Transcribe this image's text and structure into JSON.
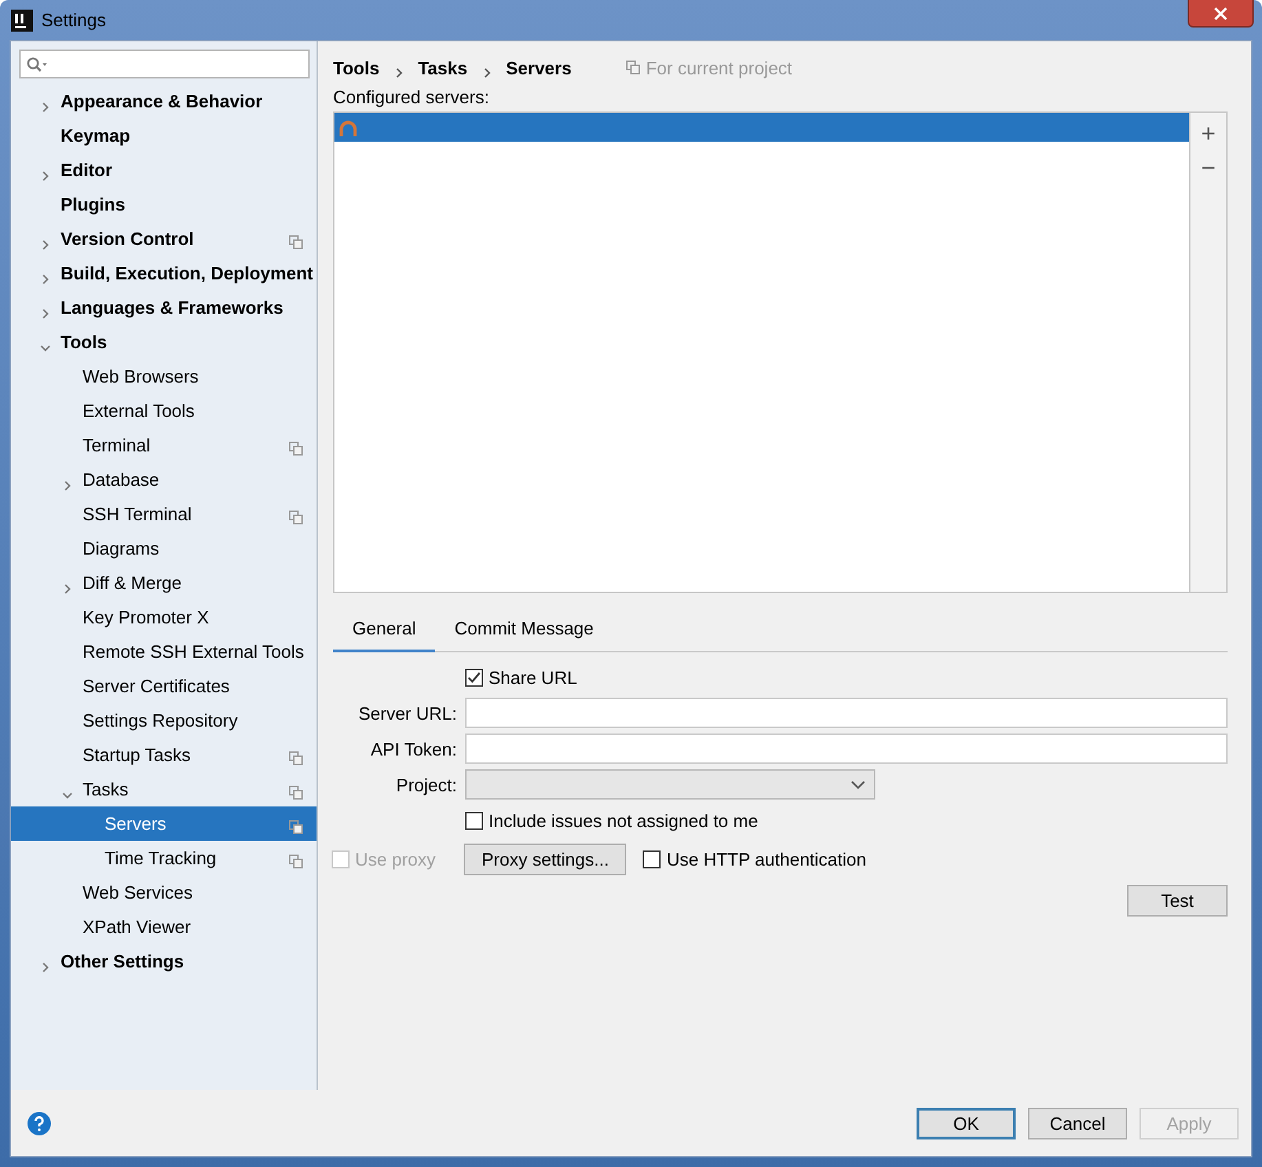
{
  "window": {
    "title": "Settings"
  },
  "sidebar": {
    "items": [
      {
        "label": "Appearance & Behavior",
        "expanded": false,
        "selected": false
      },
      {
        "label": "Keymap",
        "selected": false
      },
      {
        "label": "Editor",
        "expanded": false,
        "selected": false
      },
      {
        "label": "Plugins",
        "selected": false
      },
      {
        "label": "Version Control",
        "expanded": false,
        "project_scope": true,
        "selected": false
      },
      {
        "label": "Build, Execution, Deployment",
        "expanded": false,
        "selected": false
      },
      {
        "label": "Languages & Frameworks",
        "expanded": false,
        "selected": false
      },
      {
        "label": "Tools",
        "expanded": true,
        "selected": false,
        "children": [
          {
            "label": "Web Browsers",
            "selected": false
          },
          {
            "label": "External Tools",
            "selected": false
          },
          {
            "label": "Terminal",
            "project_scope": true,
            "selected": false
          },
          {
            "label": "Database",
            "expanded": false,
            "selected": false
          },
          {
            "label": "SSH Terminal",
            "project_scope": true,
            "selected": false
          },
          {
            "label": "Diagrams",
            "selected": false
          },
          {
            "label": "Diff & Merge",
            "expanded": false,
            "selected": false
          },
          {
            "label": "Key Promoter X",
            "selected": false
          },
          {
            "label": "Remote SSH External Tools",
            "selected": false
          },
          {
            "label": "Server Certificates",
            "selected": false
          },
          {
            "label": "Settings Repository",
            "selected": false
          },
          {
            "label": "Startup Tasks",
            "project_scope": true,
            "selected": false
          },
          {
            "label": "Tasks",
            "expanded": true,
            "project_scope": true,
            "selected": false,
            "children": [
              {
                "label": "Servers",
                "project_scope": true,
                "selected": true
              },
              {
                "label": "Time Tracking",
                "project_scope": true,
                "selected": false
              }
            ]
          },
          {
            "label": "Web Services",
            "selected": false
          },
          {
            "label": "XPath Viewer",
            "selected": false
          }
        ]
      },
      {
        "label": "Other Settings",
        "expanded": false,
        "selected": false
      }
    ]
  },
  "breadcrumb": [
    "Tools",
    "Tasks",
    "Servers"
  ],
  "scope_note": "For current project",
  "servers": {
    "label": "Configured servers:",
    "items": [
      {
        "selected": true
      }
    ],
    "add": "+",
    "remove": "−"
  },
  "tabs": [
    {
      "label": "General",
      "selected": true
    },
    {
      "label": "Commit Message",
      "selected": false
    }
  ],
  "form": {
    "share_url": {
      "label": "Share URL",
      "checked": true
    },
    "server_url": {
      "label": "Server URL:"
    },
    "api_token": {
      "label": "API Token:"
    },
    "project": {
      "label": "Project:"
    },
    "include_issues": {
      "label": "Include issues not assigned to me",
      "checked": false
    },
    "use_proxy": {
      "label": "Use proxy",
      "checked": false,
      "disabled": true
    },
    "proxy_button": "Proxy settings...",
    "http_auth": {
      "label": "Use HTTP authentication",
      "checked": false
    },
    "test_button": "Test"
  },
  "buttons": [
    {
      "label": "OK",
      "default": true,
      "disabled": false
    },
    {
      "label": "Cancel",
      "default": false,
      "disabled": false
    },
    {
      "label": "Apply",
      "default": false,
      "disabled": true
    }
  ]
}
